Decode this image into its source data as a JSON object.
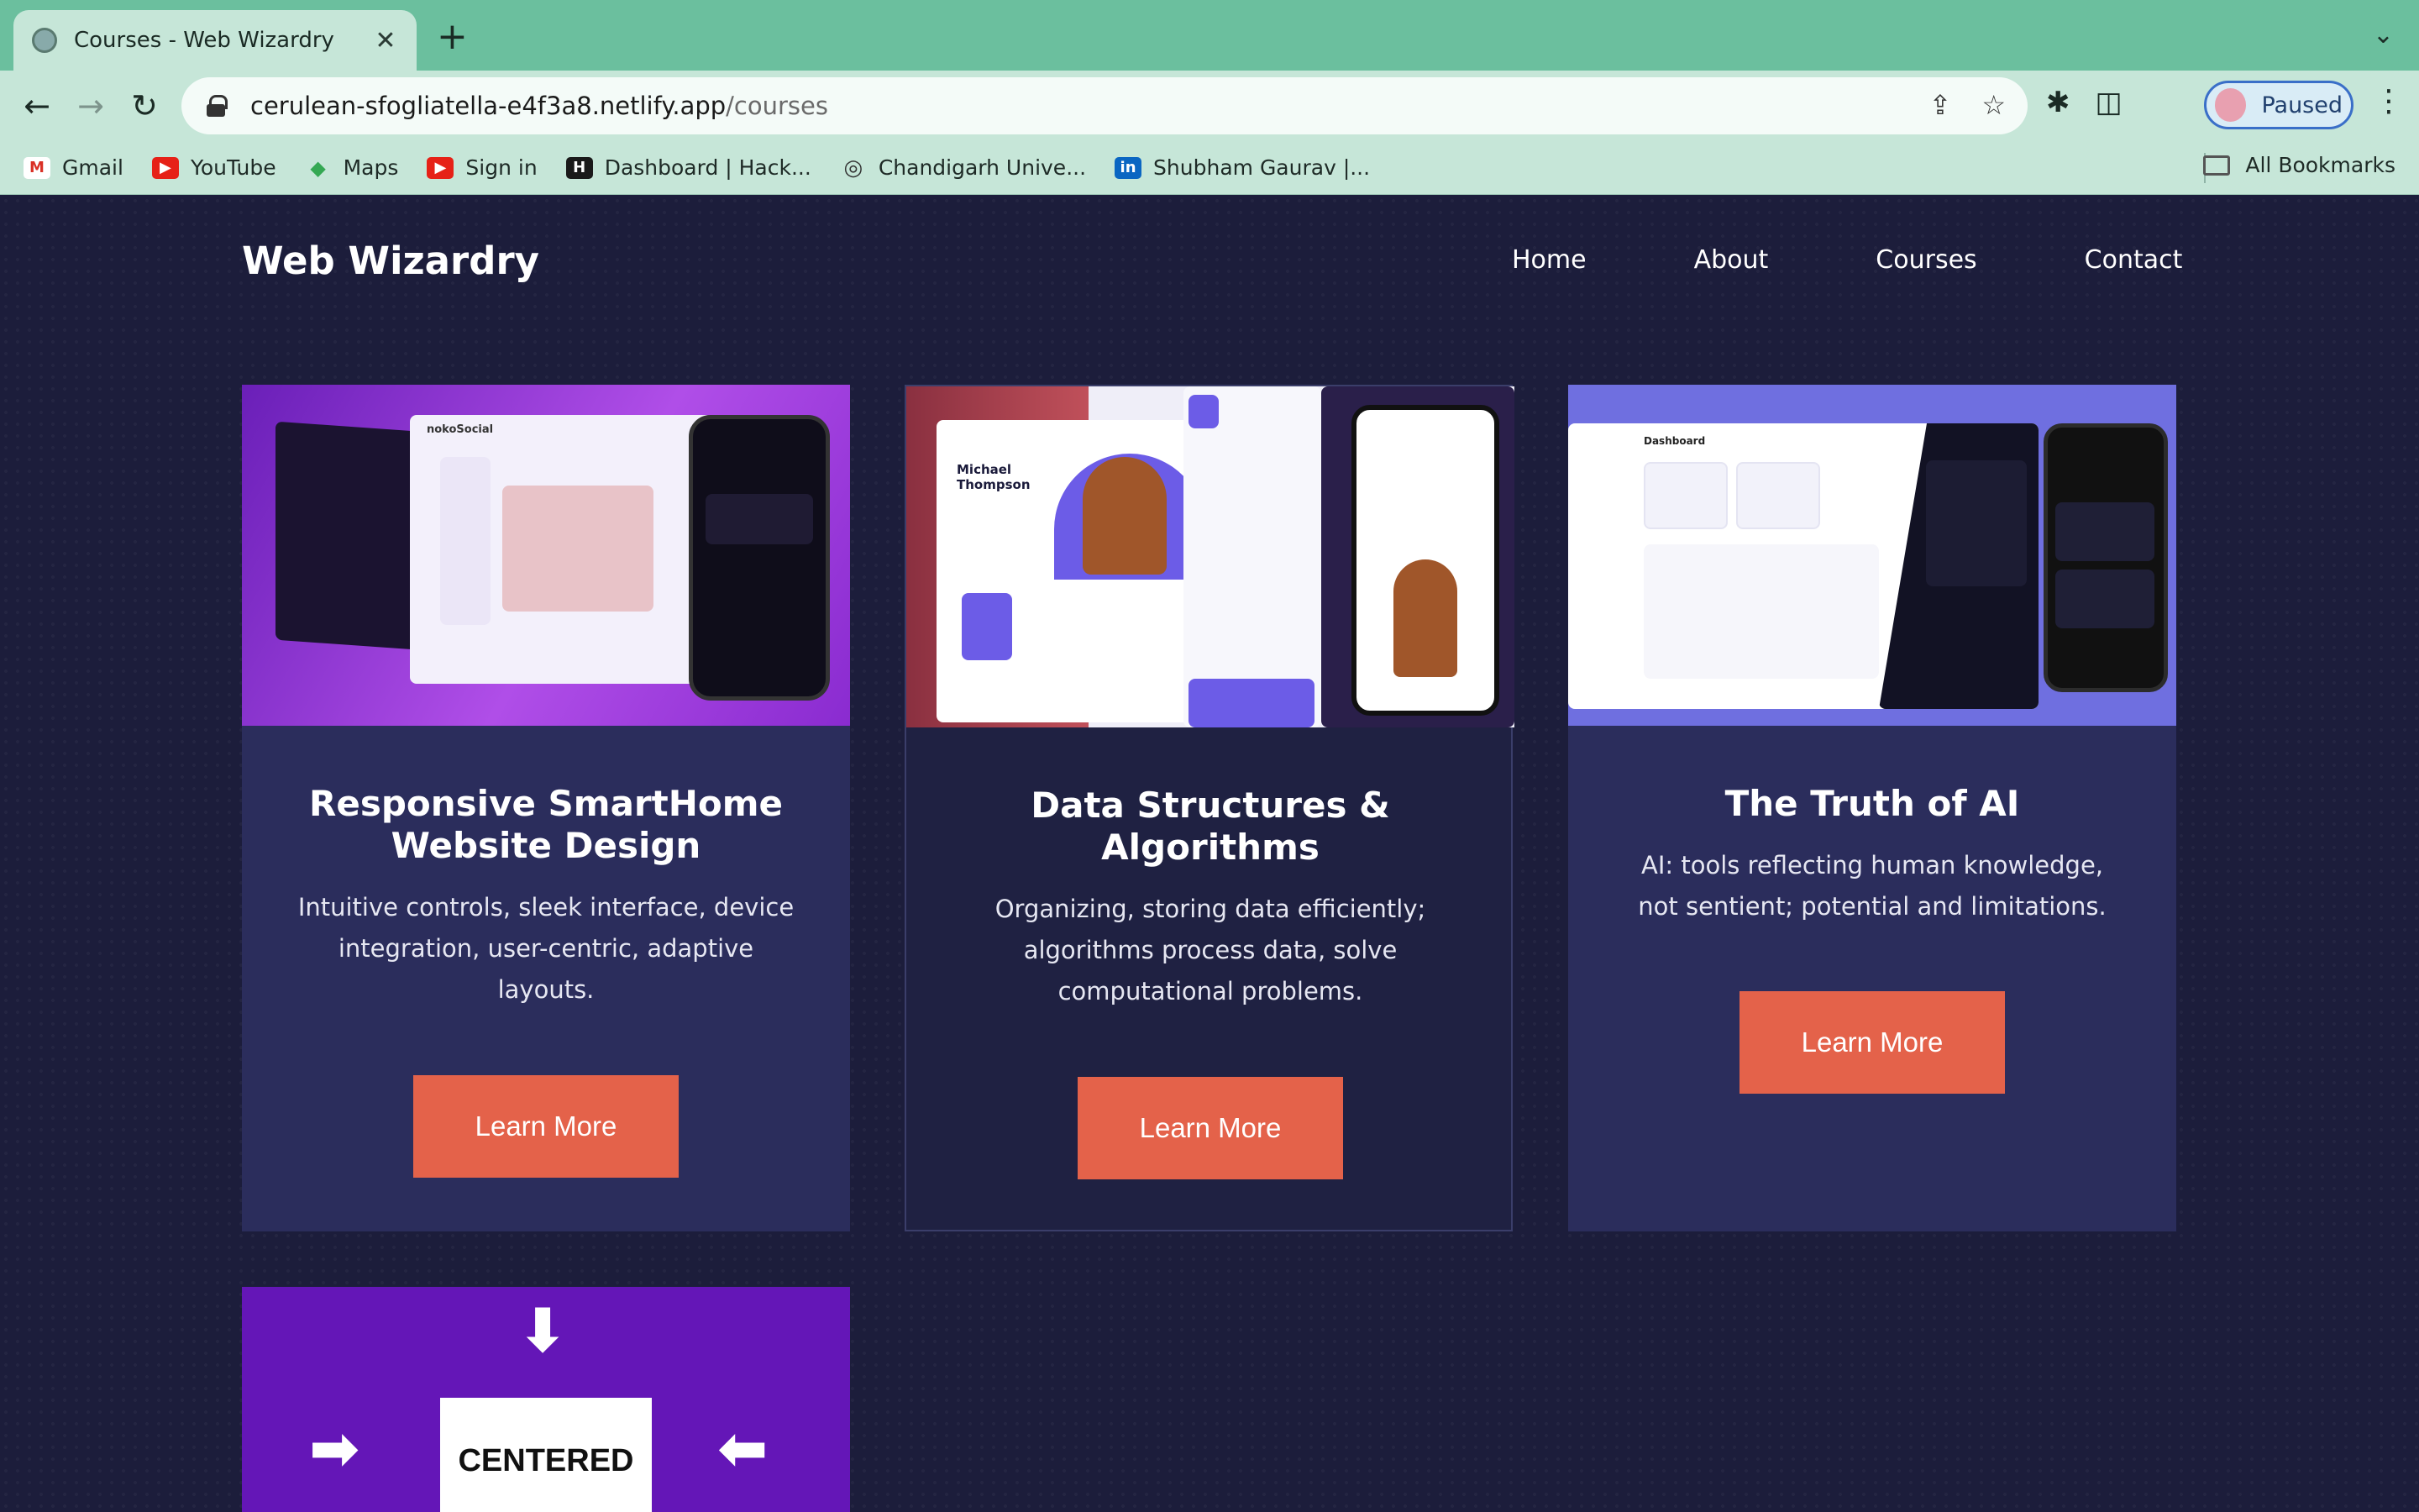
{
  "browser": {
    "tab_title": "Courses - Web Wizardry",
    "close_glyph": "✕",
    "new_tab_glyph": "+",
    "tab_menu_glyph": "⌄",
    "url_host": "cerulean-sfogliatella-e4f3a8.netlify.app",
    "url_path": "/courses",
    "profile_label": "Paused",
    "back_glyph": "←",
    "forward_glyph": "→",
    "reload_glyph": "↻",
    "share_glyph": "⇪",
    "star_glyph": "☆",
    "extensions_glyph": "✱",
    "sidepanel_glyph": "◫",
    "menu_glyph": "⋮"
  },
  "bookmarks": [
    {
      "label": "Gmail",
      "icon": "gmail-icon",
      "color": "#d93025",
      "glyph": "M"
    },
    {
      "label": "YouTube",
      "icon": "youtube-icon",
      "color": "#e62117",
      "glyph": "▶"
    },
    {
      "label": "Maps",
      "icon": "maps-icon",
      "color": "#34a853",
      "glyph": "◆"
    },
    {
      "label": "Sign in",
      "icon": "youtube-icon",
      "color": "#e62117",
      "glyph": "▶"
    },
    {
      "label": "Dashboard | Hack...",
      "icon": "hackerrank-icon",
      "color": "#1a1a1a",
      "glyph": "H"
    },
    {
      "label": "Chandigarh Unive...",
      "icon": "globe-icon",
      "color": "#333333",
      "glyph": "◎"
    },
    {
      "label": "Shubham Gaurav |...",
      "icon": "linkedin-icon",
      "color": "#0a66c2",
      "glyph": "in"
    }
  ],
  "bookmarks_all": "All Bookmarks",
  "site": {
    "brand": "Web Wizardry",
    "nav": [
      "Home",
      "About",
      "Courses",
      "Contact"
    ]
  },
  "cards": [
    {
      "title": "Responsive SmartHome Website Design",
      "description": "Intuitive controls, sleek interface, device integration, user-centric, adaptive layouts.",
      "button": "Learn More",
      "thumb_text": "nokoSocial"
    },
    {
      "title": "Data Structures & Algorithms",
      "description": "Organizing, storing data efficiently; algorithms process data, solve computational problems.",
      "button": "Learn More",
      "thumb_text": "Michael Thompson"
    },
    {
      "title": "The Truth of AI",
      "description": "AI: tools reflecting human knowledge, not sentient; potential and limitations.",
      "button": "Learn More",
      "thumb_text": "Dashboard"
    },
    {
      "title": "",
      "description": "",
      "button": "",
      "thumb_text": "CENTERED"
    }
  ],
  "colors": {
    "page_bg": "#1c1d3b",
    "card_bg": "#2b2d5c",
    "accent_button": "#e4624a",
    "browser_frame": "#6bbf9e"
  }
}
